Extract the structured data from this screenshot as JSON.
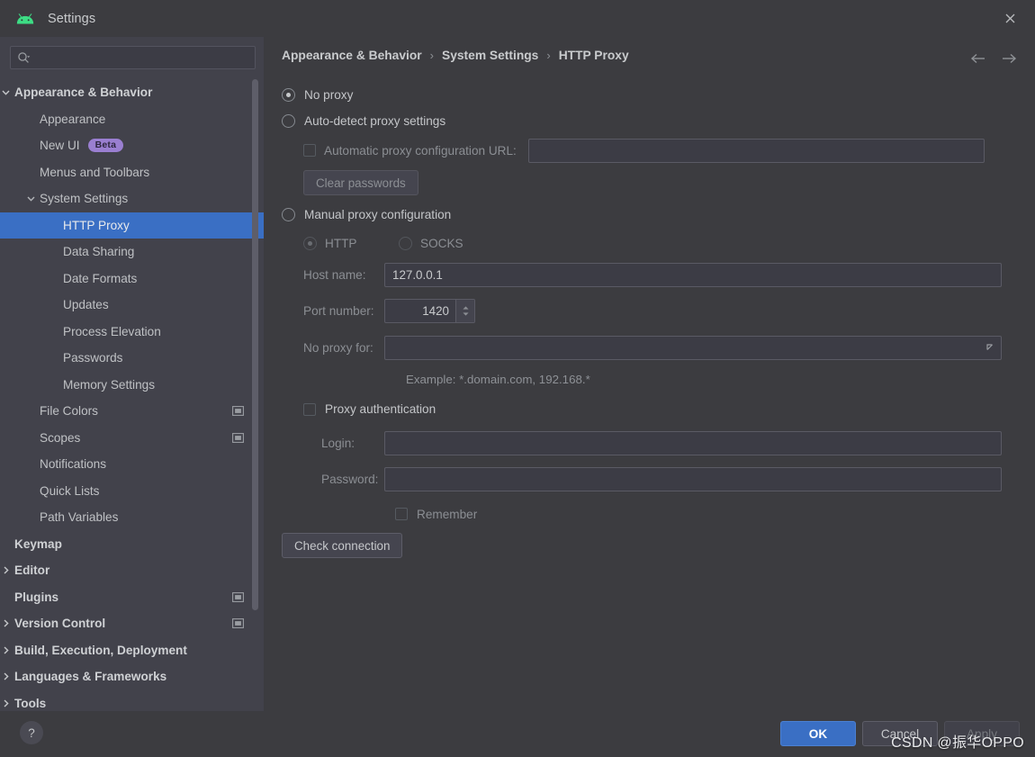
{
  "window": {
    "title": "Settings",
    "logo_icon": "android-logo-icon",
    "close_icon": "close-icon"
  },
  "search": {
    "value": "",
    "placeholder": "",
    "icon": "search-icon"
  },
  "sidebar": {
    "items": [
      {
        "label": "Appearance & Behavior",
        "indent": 0,
        "bold": true,
        "chevron": "chevron-down-icon",
        "selected": false,
        "badge": null,
        "config_icon": false
      },
      {
        "label": "Appearance",
        "indent": 1,
        "bold": false,
        "chevron": null,
        "selected": false,
        "badge": null,
        "config_icon": false
      },
      {
        "label": "New UI",
        "indent": 1,
        "bold": false,
        "chevron": null,
        "selected": false,
        "badge": "Beta",
        "config_icon": false
      },
      {
        "label": "Menus and Toolbars",
        "indent": 1,
        "bold": false,
        "chevron": null,
        "selected": false,
        "badge": null,
        "config_icon": false
      },
      {
        "label": "System Settings",
        "indent": 1,
        "bold": false,
        "chevron": "chevron-down-icon",
        "selected": false,
        "badge": null,
        "config_icon": false
      },
      {
        "label": "HTTP Proxy",
        "indent": 2,
        "bold": false,
        "chevron": null,
        "selected": true,
        "badge": null,
        "config_icon": false
      },
      {
        "label": "Data Sharing",
        "indent": 2,
        "bold": false,
        "chevron": null,
        "selected": false,
        "badge": null,
        "config_icon": false
      },
      {
        "label": "Date Formats",
        "indent": 2,
        "bold": false,
        "chevron": null,
        "selected": false,
        "badge": null,
        "config_icon": false
      },
      {
        "label": "Updates",
        "indent": 2,
        "bold": false,
        "chevron": null,
        "selected": false,
        "badge": null,
        "config_icon": false
      },
      {
        "label": "Process Elevation",
        "indent": 2,
        "bold": false,
        "chevron": null,
        "selected": false,
        "badge": null,
        "config_icon": false
      },
      {
        "label": "Passwords",
        "indent": 2,
        "bold": false,
        "chevron": null,
        "selected": false,
        "badge": null,
        "config_icon": false
      },
      {
        "label": "Memory Settings",
        "indent": 2,
        "bold": false,
        "chevron": null,
        "selected": false,
        "badge": null,
        "config_icon": false
      },
      {
        "label": "File Colors",
        "indent": 1,
        "bold": false,
        "chevron": null,
        "selected": false,
        "badge": null,
        "config_icon": true
      },
      {
        "label": "Scopes",
        "indent": 1,
        "bold": false,
        "chevron": null,
        "selected": false,
        "badge": null,
        "config_icon": true
      },
      {
        "label": "Notifications",
        "indent": 1,
        "bold": false,
        "chevron": null,
        "selected": false,
        "badge": null,
        "config_icon": false
      },
      {
        "label": "Quick Lists",
        "indent": 1,
        "bold": false,
        "chevron": null,
        "selected": false,
        "badge": null,
        "config_icon": false
      },
      {
        "label": "Path Variables",
        "indent": 1,
        "bold": false,
        "chevron": null,
        "selected": false,
        "badge": null,
        "config_icon": false
      },
      {
        "label": "Keymap",
        "indent": 0,
        "bold": true,
        "chevron": null,
        "selected": false,
        "badge": null,
        "config_icon": false
      },
      {
        "label": "Editor",
        "indent": 0,
        "bold": true,
        "chevron": "chevron-right-icon",
        "selected": false,
        "badge": null,
        "config_icon": false
      },
      {
        "label": "Plugins",
        "indent": 0,
        "bold": true,
        "chevron": null,
        "selected": false,
        "badge": null,
        "config_icon": true
      },
      {
        "label": "Version Control",
        "indent": 0,
        "bold": true,
        "chevron": "chevron-right-icon",
        "selected": false,
        "badge": null,
        "config_icon": true
      },
      {
        "label": "Build, Execution, Deployment",
        "indent": 0,
        "bold": true,
        "chevron": "chevron-right-icon",
        "selected": false,
        "badge": null,
        "config_icon": false
      },
      {
        "label": "Languages & Frameworks",
        "indent": 0,
        "bold": true,
        "chevron": "chevron-right-icon",
        "selected": false,
        "badge": null,
        "config_icon": false
      },
      {
        "label": "Tools",
        "indent": 0,
        "bold": true,
        "chevron": "chevron-right-icon",
        "selected": false,
        "badge": null,
        "config_icon": false
      }
    ]
  },
  "breadcrumb": {
    "crumbs": [
      "Appearance & Behavior",
      "System Settings",
      "HTTP Proxy"
    ],
    "separator": "›",
    "back_icon": "arrow-left-icon",
    "forward_icon": "arrow-right-icon"
  },
  "proxy": {
    "no_proxy": {
      "label": "No proxy",
      "checked": true
    },
    "auto_detect": {
      "label": "Auto-detect proxy settings",
      "checked": false
    },
    "auto_config_url": {
      "label": "Automatic proxy configuration URL:",
      "checked": false,
      "value": "",
      "placeholder": ""
    },
    "clear_passwords": {
      "label": "Clear passwords",
      "enabled": false
    },
    "manual": {
      "label": "Manual proxy configuration",
      "checked": false
    },
    "protocol": {
      "http": {
        "label": "HTTP",
        "checked": true
      },
      "socks": {
        "label": "SOCKS",
        "checked": false
      }
    },
    "host_name": {
      "label": "Host name:",
      "value": "127.0.0.1",
      "placeholder": ""
    },
    "port_number": {
      "label": "Port number:",
      "value": "1420"
    },
    "no_proxy_for": {
      "label": "No proxy for:",
      "value": "",
      "placeholder": "",
      "expand_icon": "expand-icon"
    },
    "example_hint": "Example: *.domain.com, 192.168.*",
    "proxy_auth": {
      "label": "Proxy authentication",
      "checked": false
    },
    "login": {
      "label": "Login:",
      "value": "",
      "placeholder": ""
    },
    "password": {
      "label": "Password:",
      "value": "",
      "placeholder": ""
    },
    "remember": {
      "label": "Remember",
      "checked": false
    },
    "check_connection": {
      "label": "Check connection",
      "enabled": true
    }
  },
  "footer": {
    "help_label": "?",
    "ok": {
      "label": "OK",
      "enabled": true
    },
    "cancel": {
      "label": "Cancel",
      "enabled": true
    },
    "apply": {
      "label": "Apply",
      "enabled": false
    }
  },
  "watermark": "CSDN @振华OPPO",
  "colors": {
    "accent": "#3a6fc4",
    "window_bg": "#3c3c40",
    "sidebar_bg": "#42424b",
    "badge_bg": "#9a7fd1",
    "logo_green": "#3ddc84"
  }
}
